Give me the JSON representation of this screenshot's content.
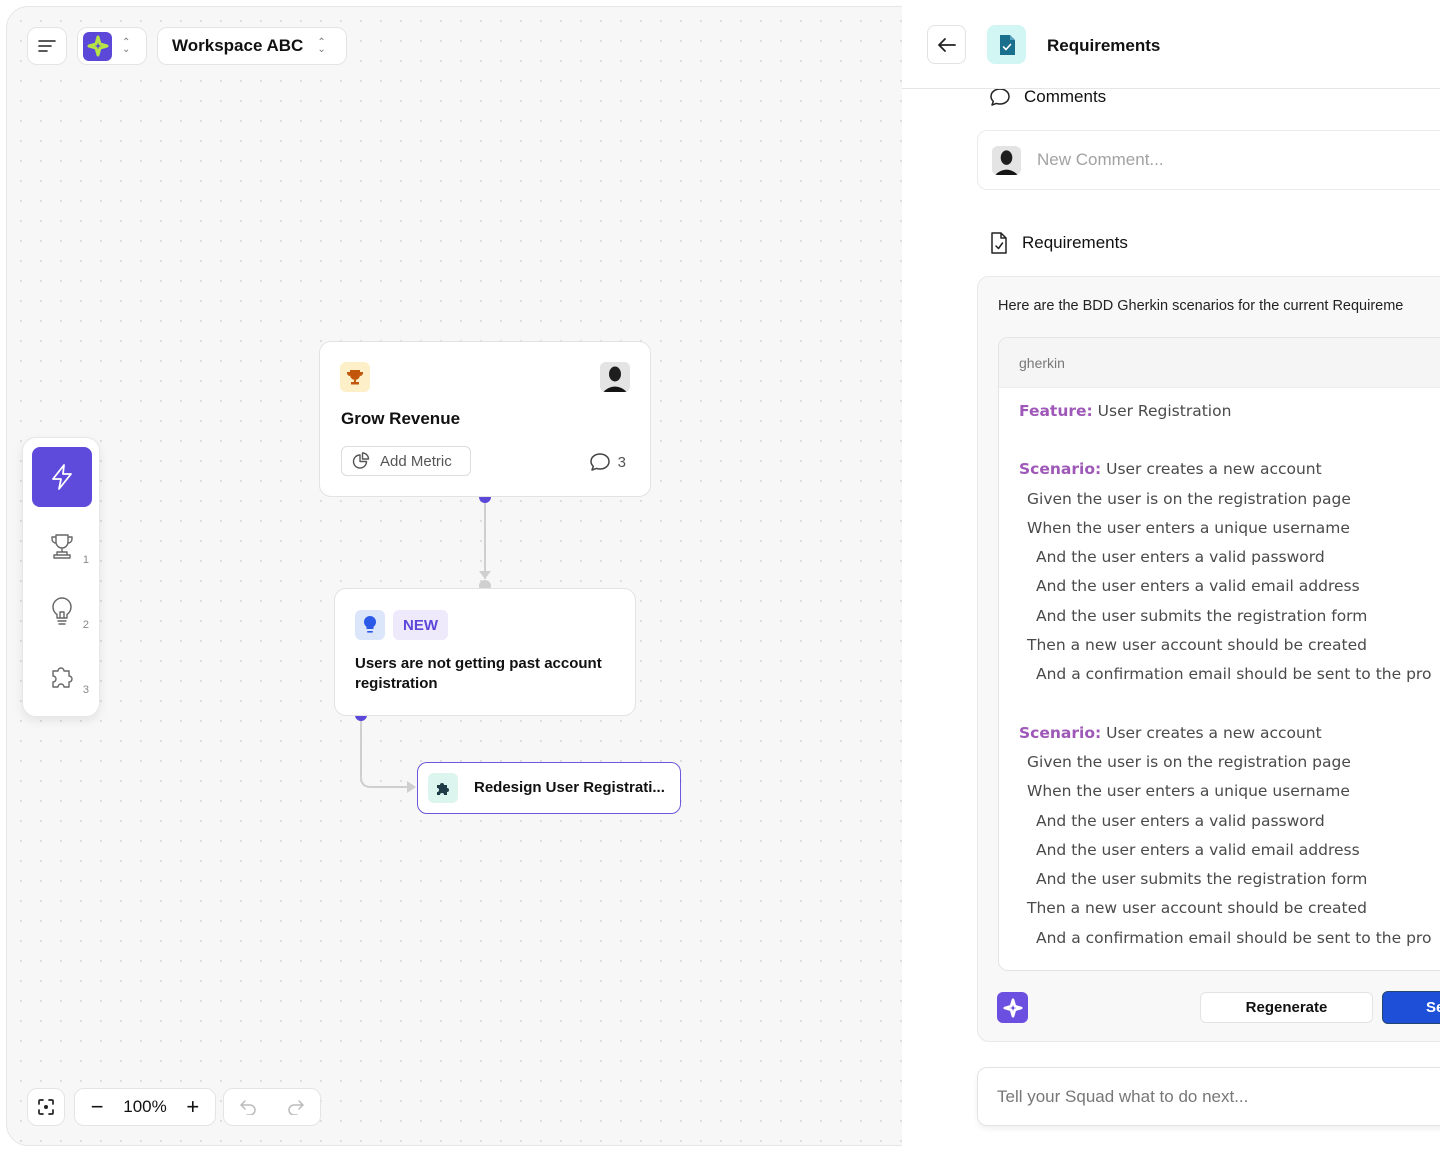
{
  "canvas": {
    "toolbar": {
      "menu_icon": "menu-lines-icon",
      "app_logo_icon": "sparkle-logo-icon",
      "workspace_label": "Workspace ABC"
    },
    "left_tools": [
      {
        "name": "lightning",
        "icon": "lightning-icon",
        "count": "",
        "active": true
      },
      {
        "name": "goals",
        "icon": "trophy-icon",
        "count": "1"
      },
      {
        "name": "ideas",
        "icon": "lightbulb-icon",
        "count": "2"
      },
      {
        "name": "solutions",
        "icon": "puzzle-icon",
        "count": "3"
      }
    ],
    "nodes": {
      "goal": {
        "icon": "trophy-icon",
        "title": "Grow Revenue",
        "metric_button": "Add Metric",
        "comment_count": "3"
      },
      "problem": {
        "icon": "lightbulb-icon",
        "badge": "NEW",
        "text": "Users are not getting past account registration"
      },
      "solution": {
        "icon": "puzzle-icon",
        "text": "Redesign User Registrati..."
      }
    },
    "bottom_toolbar": {
      "zoom_level": "100%",
      "zoom_out": "−",
      "zoom_in": "+"
    }
  },
  "panel": {
    "title": "Requirements",
    "comments": {
      "heading": "Comments",
      "placeholder": "New Comment..."
    },
    "requirements": {
      "heading": "Requirements",
      "intro": "Here are the BDD Gherkin scenarios for the current Requireme",
      "code_language": "gherkin",
      "lines": [
        {
          "kw": "Feature:",
          "text": " User Registration",
          "indent": 0
        },
        {
          "kw": "",
          "text": "",
          "indent": 0,
          "blank": true
        },
        {
          "kw": "Scenario:",
          "text": " User creates a new account",
          "indent": 0
        },
        {
          "kw": "",
          "text": "Given the user is on the registration page",
          "indent": 1
        },
        {
          "kw": "",
          "text": "When the user enters a unique username",
          "indent": 1
        },
        {
          "kw": "",
          "text": "And the user enters a valid password",
          "indent": 2
        },
        {
          "kw": "",
          "text": "And the user enters a valid email address",
          "indent": 2
        },
        {
          "kw": "",
          "text": "And the user submits the registration form",
          "indent": 2
        },
        {
          "kw": "",
          "text": "Then a new user account should be created",
          "indent": 1
        },
        {
          "kw": "",
          "text": "And a confirmation email should be sent to the pro",
          "indent": 2
        },
        {
          "kw": "",
          "text": "",
          "indent": 0,
          "blank": true
        },
        {
          "kw": "Scenario:",
          "text": " User creates a new account",
          "indent": 0
        },
        {
          "kw": "",
          "text": "Given the user is on the registration page",
          "indent": 1
        },
        {
          "kw": "",
          "text": "When the user enters a unique username",
          "indent": 1
        },
        {
          "kw": "",
          "text": "And the user enters a valid password",
          "indent": 2
        },
        {
          "kw": "",
          "text": "And the user enters a valid email address",
          "indent": 2
        },
        {
          "kw": "",
          "text": "And the user submits the registration form",
          "indent": 2
        },
        {
          "kw": "",
          "text": "Then a new user account should be created",
          "indent": 1
        },
        {
          "kw": "",
          "text": "And a confirmation email should be sent to the pro",
          "indent": 2
        }
      ],
      "regenerate_label": "Regenerate",
      "save_label": "Se"
    },
    "squad_input": {
      "placeholder": "Tell your Squad what to do next..."
    }
  },
  "colors": {
    "accent_purple": "#5f4bdb",
    "primary_blue": "#1d4fd8",
    "keyword_purple": "#9e58b7",
    "lime": "#b6e446"
  }
}
